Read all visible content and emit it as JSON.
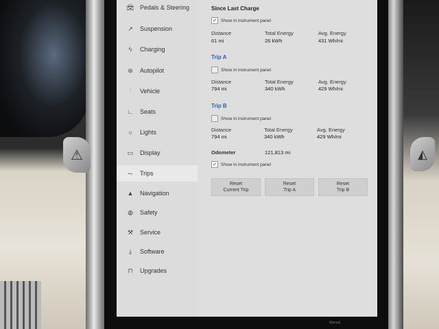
{
  "sidebar": {
    "items": [
      {
        "label": "Pedals & Steering",
        "icon": "car-icon"
      },
      {
        "label": "Suspension",
        "icon": "suspension-icon"
      },
      {
        "label": "Charging",
        "icon": "bolt-icon"
      },
      {
        "label": "Autopilot",
        "icon": "steering-wheel-icon"
      },
      {
        "label": "Vehicle",
        "icon": "sliders-icon"
      },
      {
        "label": "Seats",
        "icon": "seat-icon"
      },
      {
        "label": "Lights",
        "icon": "sun-icon"
      },
      {
        "label": "Display",
        "icon": "display-icon"
      },
      {
        "label": "Trips",
        "icon": "trips-icon"
      },
      {
        "label": "Navigation",
        "icon": "navigation-icon"
      },
      {
        "label": "Safety",
        "icon": "safety-icon"
      },
      {
        "label": "Service",
        "icon": "wrench-icon"
      },
      {
        "label": "Software",
        "icon": "download-icon"
      },
      {
        "label": "Upgrades",
        "icon": "bag-icon"
      }
    ],
    "active": "Trips"
  },
  "since_last_charge": {
    "title": "Since Last Charge",
    "show_label": "Show in instrument panel",
    "checked": true,
    "distance_label": "Distance",
    "distance_value": "61 mi",
    "energy_label": "Total Energy",
    "energy_value": "26 kWh",
    "avg_label": "Avg. Energy",
    "avg_value": "431 Wh/mi"
  },
  "trip_a": {
    "title": "Trip A",
    "show_label": "Show in instrument panel",
    "checked": false,
    "distance_label": "Distance",
    "distance_value": "794 mi",
    "energy_label": "Total Energy",
    "energy_value": "340 kWh",
    "avg_label": "Avg. Energy",
    "avg_value": "429 Wh/mi"
  },
  "trip_b": {
    "title": "Trip B",
    "show_label": "Show in instrument panel",
    "checked": false,
    "distance_label": "Distance",
    "distance_value": "794 mi",
    "energy_label": "Total Energy",
    "energy_value": "340 kWh",
    "avg_label": "Avg. Energy",
    "avg_value": "429 Wh/mi"
  },
  "odometer": {
    "label": "Odometer",
    "value": "121,813 mi",
    "show_label": "Show in instrument panel",
    "checked": true
  },
  "buttons": {
    "reset_current_l1": "Reset",
    "reset_current_l2": "Current Trip",
    "reset_a_l1": "Reset",
    "reset_a_l2": "Trip A",
    "reset_b_l1": "Reset",
    "reset_b_l2": "Trip B"
  },
  "bottom": {
    "label": "Manual"
  },
  "colors": {
    "accent": "#2b5db5",
    "screen_bg": "#dedede"
  }
}
